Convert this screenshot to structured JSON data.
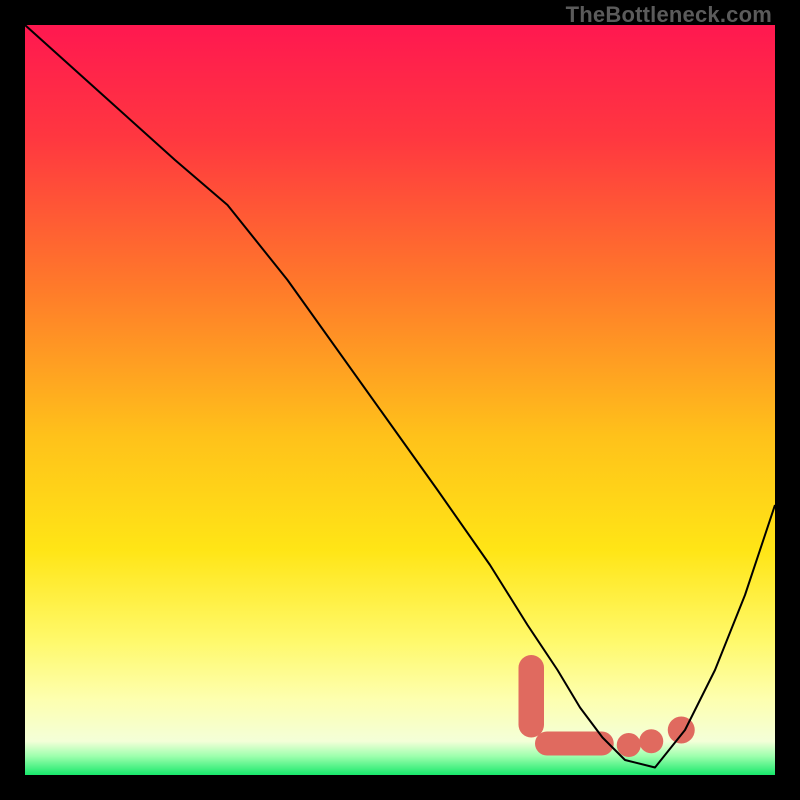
{
  "watermark": "TheBottleneck.com",
  "chart_data": {
    "type": "line",
    "title": "",
    "xlabel": "",
    "ylabel": "",
    "xlim": [
      0,
      100
    ],
    "ylim": [
      0,
      100
    ],
    "grid": false,
    "legend": false,
    "gradient_stops": [
      {
        "offset": 0.0,
        "color": "#ff1850"
      },
      {
        "offset": 0.15,
        "color": "#ff3740"
      },
      {
        "offset": 0.35,
        "color": "#ff7a2a"
      },
      {
        "offset": 0.55,
        "color": "#ffc21a"
      },
      {
        "offset": 0.7,
        "color": "#ffe516"
      },
      {
        "offset": 0.82,
        "color": "#fff96a"
      },
      {
        "offset": 0.9,
        "color": "#fdffb0"
      },
      {
        "offset": 0.955,
        "color": "#f4ffd8"
      },
      {
        "offset": 0.975,
        "color": "#9dffad"
      },
      {
        "offset": 1.0,
        "color": "#17e86b"
      }
    ],
    "series": [
      {
        "name": "bottleneck-curve",
        "color": "#000000",
        "stroke_width": 2,
        "x": [
          0,
          10,
          20,
          27,
          35,
          45,
          55,
          62,
          67,
          71,
          74,
          77,
          80,
          84,
          88,
          92,
          96,
          100
        ],
        "y": [
          100,
          91,
          82,
          76,
          66,
          52,
          38,
          28,
          20,
          14,
          9,
          5,
          2,
          1,
          6,
          14,
          24,
          36
        ]
      }
    ],
    "highlight_band": {
      "color": "#e06a5f",
      "segments": [
        {
          "type": "vthick",
          "x": 67.5,
          "y_from": 5,
          "y_to": 16,
          "w": 3.4
        },
        {
          "type": "hthick",
          "x_from": 68,
          "x_to": 78.5,
          "y": 4.2,
          "h": 3.2
        },
        {
          "type": "dot",
          "x": 80.5,
          "y": 4.0,
          "r": 1.6
        },
        {
          "type": "dot",
          "x": 83.5,
          "y": 4.5,
          "r": 1.6
        },
        {
          "type": "dot",
          "x": 87.5,
          "y": 6.0,
          "r": 1.8
        }
      ]
    }
  }
}
